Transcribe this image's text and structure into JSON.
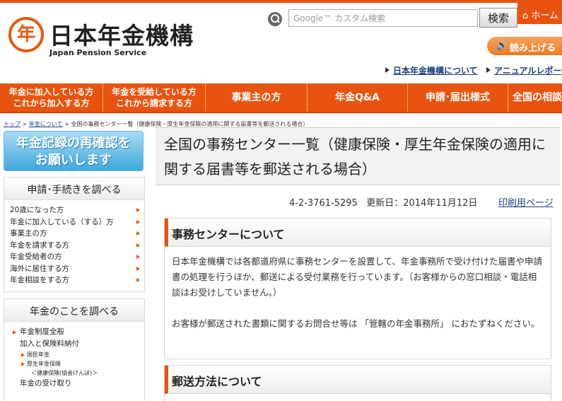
{
  "header": {
    "logo_mark": "年",
    "site_title": "日本年金機構",
    "site_subtitle": "Japan Pension Service",
    "search_placeholder": "Google™ カスタム検索",
    "search_button": "検索",
    "home_label": "⌂ ホーム",
    "read_aloud_label": "読み上げる",
    "util_links": [
      "日本年金機構について",
      "アニュアルレポー"
    ]
  },
  "nav": {
    "items": [
      {
        "line1": "年金に加入している方",
        "line2": "これから加入する方"
      },
      {
        "line1": "年金を受給している方",
        "line2": "これから請求する方"
      },
      {
        "line1": "事業主の方",
        "line2": ""
      },
      {
        "line1": "年金Q&A",
        "line2": ""
      },
      {
        "line1": "申請･届出様式",
        "line2": ""
      },
      {
        "line1": "全国の相談",
        "line2": ""
      }
    ]
  },
  "breadcrumb": {
    "home": "トップ",
    "sep": " > ",
    "level1": "年金について",
    "current": "全国の事務センター一覧（健康保険・厚生年金保険の適用に関する届書等を郵送される場合）"
  },
  "sidebar": {
    "banner_line1": "年金記録の再確認を",
    "banner_line2": "お願いします",
    "procedures_title": "申請･手続きを調べる",
    "procedures": [
      "20歳になった方",
      "年金に加入している（する）方",
      "事業主の方",
      "年金を請求する方",
      "年金受給者の方",
      "海外に居住する方",
      "年金相談をする方"
    ],
    "learn_title": "年金のことを調べる",
    "learn_items": [
      "年金制度全般",
      "加入と保険料納付",
      "国民年金",
      "厚生年金保険",
      "＜健康保険(協会けんぽ)＞",
      "年金の受け取り"
    ]
  },
  "main": {
    "title": "全国の事務センター一覧（健康保険・厚生年金保険の適用に関する届書等を郵送される場合）",
    "page_id": "4-2-3761-5295",
    "updated_label": "更新日：",
    "updated_date": "2014年11月12日",
    "print_link": "印刷用ページ",
    "section1_heading": "事務センターについて",
    "section1_para1": "日本年金機構では各都道府県に事務センターを設置して、年金事務所で受け付けた届書や申請書の処理を行うほか、郵送による受付業務を行っています。（お客様からの窓口相談・電話相談はお受けしていません。）",
    "section1_para2": "お客様が郵送された書類に関するお問合せ等は 「管轄の年金事務所」 におたずねください。",
    "section2_heading": "郵送方法について"
  },
  "colors": {
    "brand_orange": "#e8540f",
    "link_blue": "#1a3e84",
    "banner_blue": "#3fa8dc"
  },
  "icons": [
    "search-icon",
    "speaker-icon",
    "home-icon",
    "arrow-right-icon"
  ]
}
